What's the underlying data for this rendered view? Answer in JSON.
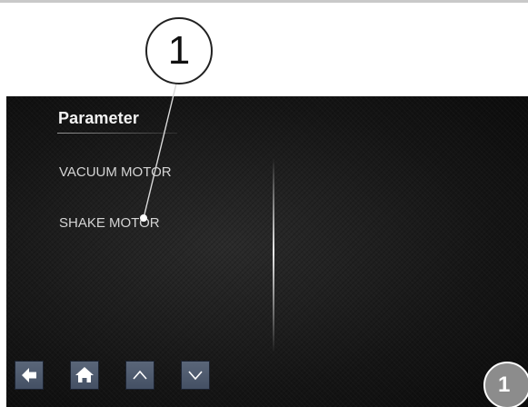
{
  "screen": {
    "title": "Parameter",
    "menu_items": [
      {
        "label": "VACUUM MOTOR"
      },
      {
        "label": "SHAKE MOTOR"
      }
    ]
  },
  "nav_buttons": [
    {
      "icon": "arrow-left-icon"
    },
    {
      "icon": "home-icon"
    },
    {
      "icon": "chevron-up-icon"
    },
    {
      "icon": "chevron-down-icon"
    }
  ],
  "annotation": {
    "callout_number": "1"
  },
  "figure_badge": "1",
  "colors": {
    "screen_background": "#1c1c1c",
    "button_fill": "#4f5b6e",
    "badge_fill": "#8c8c8c"
  }
}
